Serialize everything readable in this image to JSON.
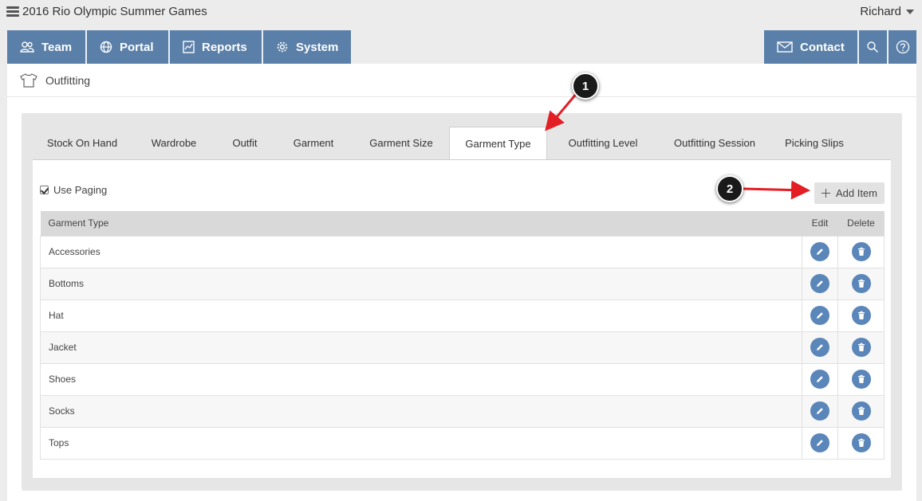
{
  "app": {
    "title": "2016 Rio Olympic Summer Games",
    "user": "Richard"
  },
  "nav": {
    "items": [
      {
        "label": "Team",
        "icon": "team-icon"
      },
      {
        "label": "Portal",
        "icon": "globe-icon"
      },
      {
        "label": "Reports",
        "icon": "reports-icon"
      },
      {
        "label": "System",
        "icon": "gear-icon"
      }
    ],
    "contact_label": "Contact",
    "color": "#5a7fa8"
  },
  "page": {
    "title": "Outfitting",
    "icon": "tshirt-icon"
  },
  "tabs": [
    {
      "label": "Stock On Hand"
    },
    {
      "label": "Wardrobe"
    },
    {
      "label": "Outfit"
    },
    {
      "label": "Garment"
    },
    {
      "label": "Garment Size"
    },
    {
      "label": "Garment Type",
      "active": true
    },
    {
      "label": "Outfitting Level"
    },
    {
      "label": "Outfitting Session"
    },
    {
      "label": "Picking Slips"
    }
  ],
  "toolbar": {
    "use_paging_label": "Use Paging",
    "use_paging_checked": true,
    "add_item_label": "Add Item"
  },
  "table": {
    "columns": [
      "Garment Type",
      "Edit",
      "Delete"
    ],
    "rows": [
      "Accessories",
      "Bottoms",
      "Hat",
      "Jacket",
      "Shoes",
      "Socks",
      "Tops"
    ]
  },
  "annotations": {
    "step1": "1",
    "step2": "2",
    "arrow_color": "#e31e24"
  }
}
